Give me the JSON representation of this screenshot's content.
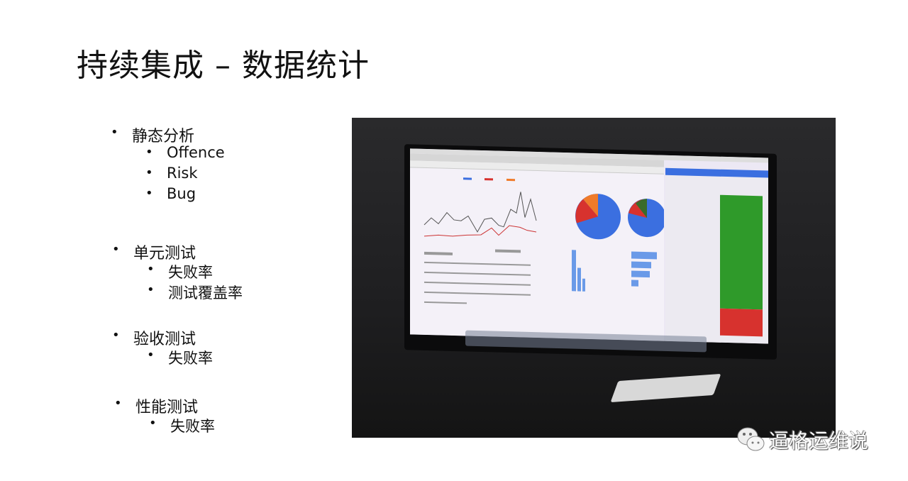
{
  "slide": {
    "title": "持续集成 – 数据统计",
    "sections": [
      {
        "label": "静态分析",
        "items": [
          "Offence",
          "Risk",
          "Bug"
        ]
      },
      {
        "label": "单元测试",
        "items": [
          "失败率",
          "测试覆盖率"
        ]
      },
      {
        "label": "验收测试",
        "items": [
          "失败率"
        ]
      },
      {
        "label": "性能测试",
        "items": [
          "失败率"
        ]
      }
    ]
  },
  "photo": {
    "description_icon": "dashboard-monitor-photo"
  },
  "watermark": {
    "text": "逼格运维说",
    "icon": "wechat-icon"
  },
  "colors": {
    "pie_blue": "#3b6fe0",
    "pie_red": "#d7322e",
    "pie_orange": "#f07b2a",
    "green_list": "#2f9a2a"
  }
}
